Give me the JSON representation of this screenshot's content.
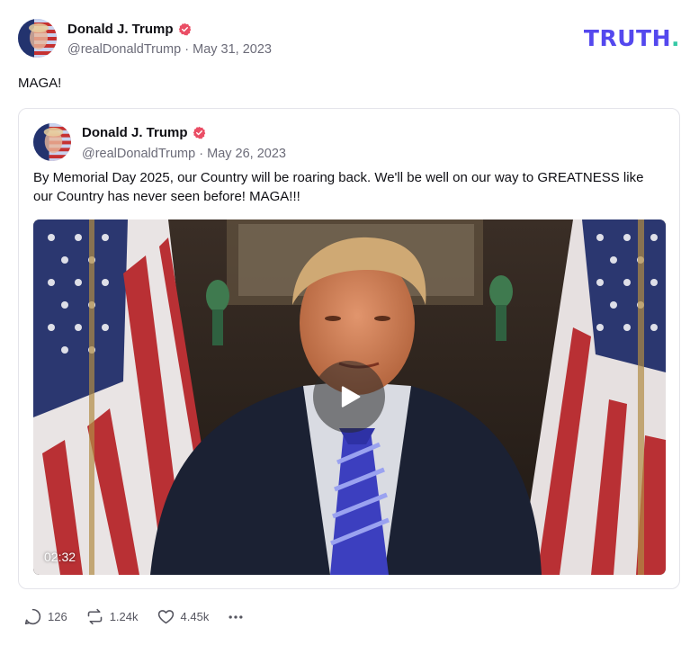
{
  "post": {
    "author": {
      "name": "Donald J. Trump",
      "handle": "@realDonaldTrump",
      "date": "May 31, 2023",
      "verified_icon": "verified-badge-icon"
    },
    "text": "MAGA!",
    "brand": {
      "logo_main": "TRUTH",
      "logo_dot": ".",
      "color": "#5448ee",
      "dot_color": "#36c9a6"
    }
  },
  "quote": {
    "author": {
      "name": "Donald J. Trump",
      "handle": "@realDonaldTrump",
      "date": "May 26, 2023"
    },
    "text": "By Memorial Day 2025, our Country will be roaring back. We'll be well on our way to GREATNESS like our Country has never seen before! MAGA!!!",
    "video": {
      "duration": "02:32",
      "play_icon": "play-icon"
    }
  },
  "actions": {
    "replies": "126",
    "retruths": "1.24k",
    "likes": "4.45k"
  },
  "separator": "·"
}
